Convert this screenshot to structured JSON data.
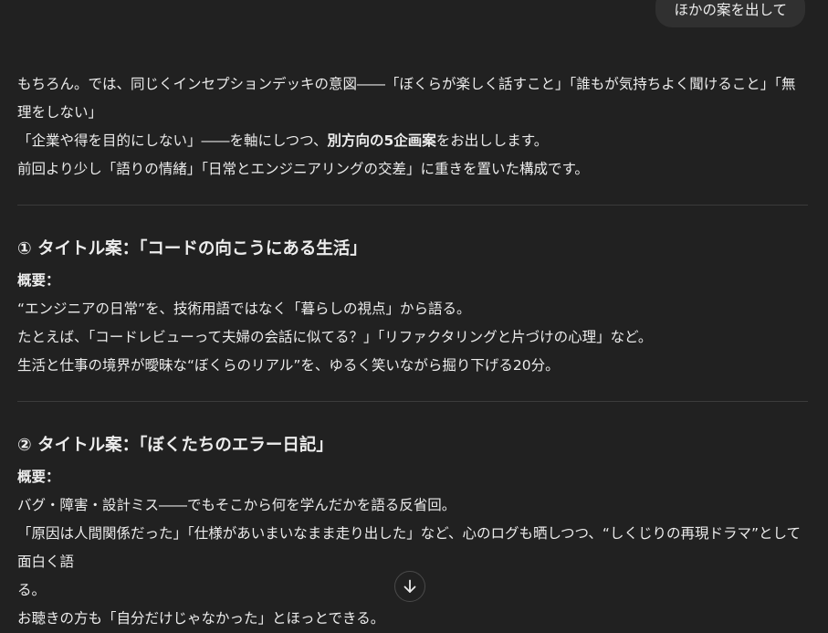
{
  "user_message": "ほかの案を出して",
  "intro": {
    "line1": "もちろん。では、同じくインセプションデッキの意図――「ぼくらが楽しく話すこと」「誰もが気持ちよく聞けること」「無理をしない」",
    "line2_a": "「企業や得を目的にしない」――を軸にしつつ、",
    "line2_bold": "別方向の5企画案",
    "line2_b": "をお出しします。",
    "line3": "前回より少し「語りの情緒」「日常とエンジニアリングの交差」に重きを置いた構成です。"
  },
  "sections": [
    {
      "title": "① タイトル案：「コードの向こうにある生活」",
      "label": "概要：",
      "lines": [
        "“エンジニアの日常”を、技術用語ではなく「暮らしの視点」から語る。",
        "たとえば、「コードレビューって夫婦の会話に似てる？」「リファクタリングと片づけの心理」など。",
        "生活と仕事の境界が曖昧な“ぼくらのリアル”を、ゆるく笑いながら掘り下げる20分。"
      ]
    },
    {
      "title": "② タイトル案：「ぼくたちのエラー日記」",
      "label": "概要：",
      "lines": [
        "バグ・障害・設計ミス――でもそこから何を学んだかを語る反省回。",
        "「原因は人間関係だった」「仕様があいまいなまま走り出した」など、心のログも晒しつつ、“しくじりの再現ドラマ”として面白く語",
        "る。",
        "お聴きの方も「自分だけじゃなかった」とほっとできる。"
      ]
    }
  ],
  "icons": {
    "scroll_down": "arrow-down-icon"
  }
}
